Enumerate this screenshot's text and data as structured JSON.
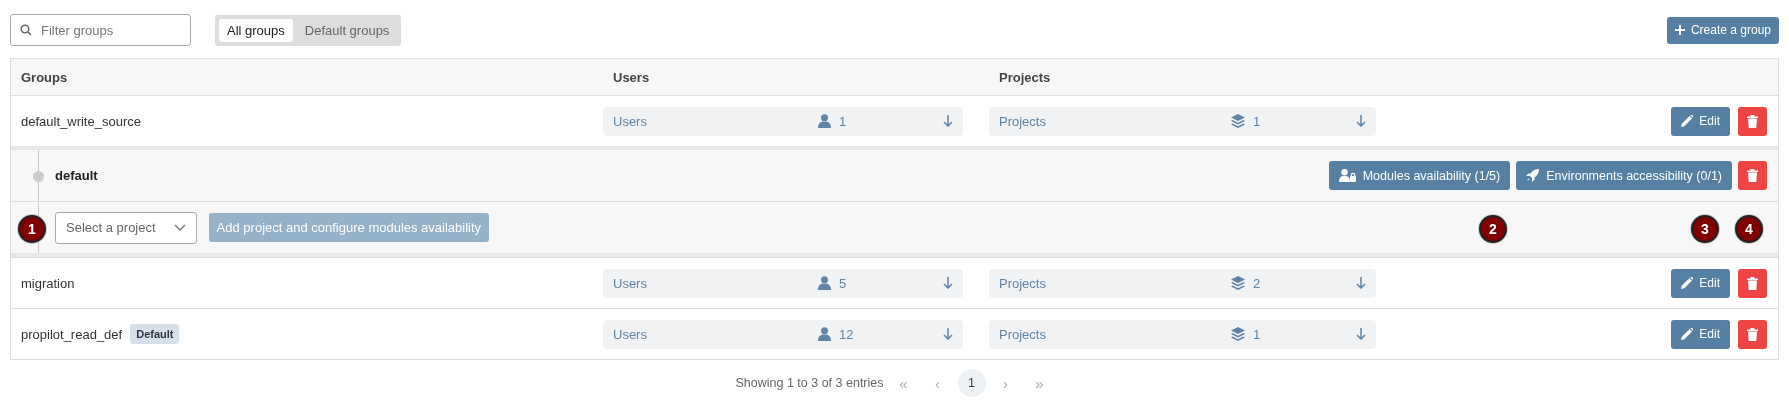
{
  "toolbar": {
    "filter_placeholder": "Filter groups",
    "filters": [
      {
        "label": "All groups",
        "selected": true
      },
      {
        "label": "Default groups",
        "selected": false
      }
    ],
    "create_button": "Create a group"
  },
  "table": {
    "columns": [
      "Groups",
      "Users",
      "Projects"
    ],
    "rows": [
      {
        "kind": "group",
        "name": "default_write_source",
        "users_label": "Users",
        "users_count": "1",
        "projects_label": "Projects",
        "projects_count": "1",
        "edit": "Edit"
      },
      {
        "kind": "project",
        "name": "default",
        "modules": "Modules availability (1/5)",
        "environments": "Environments accessibility (0/1)",
        "select_placeholder": "Select a project",
        "add_button": "Add project and configure modules availability",
        "add_disabled": true
      },
      {
        "kind": "group",
        "name": "migration",
        "users_label": "Users",
        "users_count": "5",
        "projects_label": "Projects",
        "projects_count": "2",
        "edit": "Edit"
      },
      {
        "kind": "group",
        "name": "propilot_read_def",
        "badge": "Default",
        "users_label": "Users",
        "users_count": "12",
        "projects_label": "Projects",
        "projects_count": "1",
        "edit": "Edit"
      }
    ]
  },
  "annotations": [
    "1",
    "2",
    "3",
    "4"
  ],
  "pagination": {
    "summary": "Showing 1 to 3 of 3 entries",
    "first": "«",
    "previous": "‹",
    "pages": [
      {
        "label": "1",
        "selected": true
      }
    ],
    "next": "›",
    "last": "»"
  }
}
